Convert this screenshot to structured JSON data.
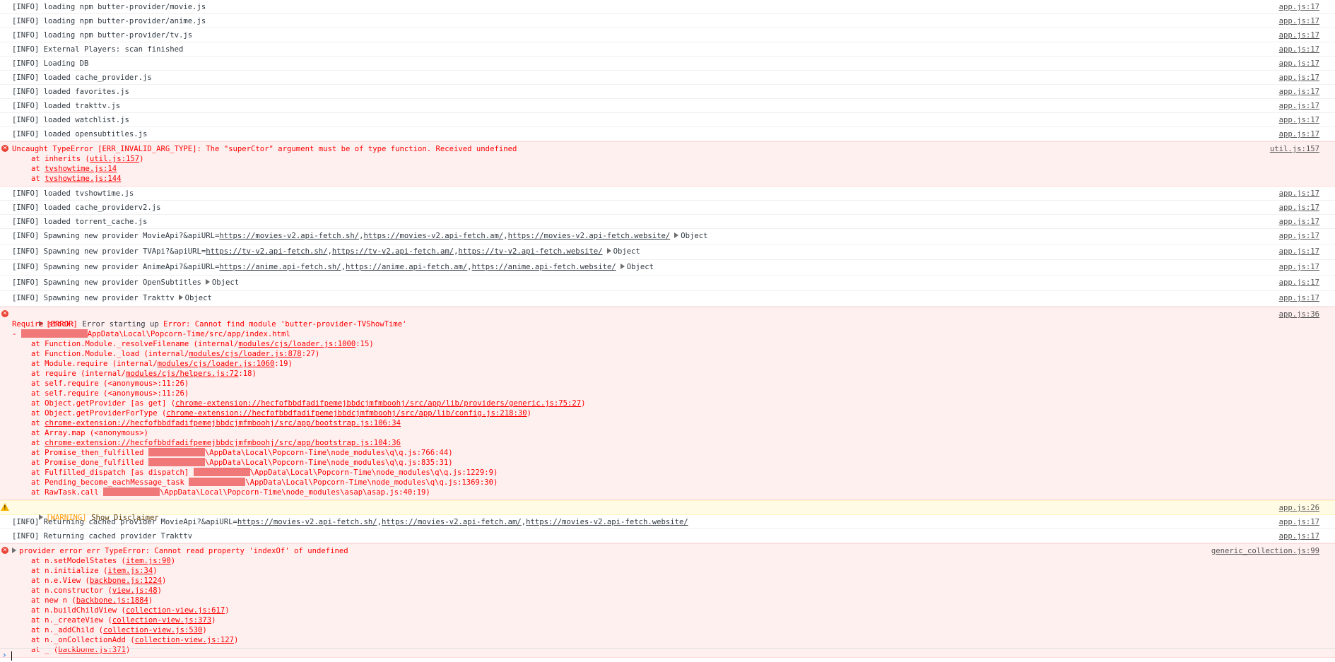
{
  "entries": [
    {
      "kind": "info",
      "text": "[INFO] loading npm butter-provider/movie.js",
      "src": "app.js:17"
    },
    {
      "kind": "info",
      "text": "[INFO] loading npm butter-provider/anime.js",
      "src": "app.js:17"
    },
    {
      "kind": "info",
      "text": "[INFO] loading npm butter-provider/tv.js",
      "src": "app.js:17"
    },
    {
      "kind": "info",
      "text": "[INFO] External Players: scan finished",
      "src": "app.js:17"
    },
    {
      "kind": "info",
      "text": "[INFO] Loading DB",
      "src": "app.js:17"
    },
    {
      "kind": "info",
      "text": "[INFO] loaded cache_provider.js",
      "src": "app.js:17"
    },
    {
      "kind": "info",
      "text": "[INFO] loaded favorites.js",
      "src": "app.js:17"
    },
    {
      "kind": "info",
      "text": "[INFO] loaded trakttv.js",
      "src": "app.js:17"
    },
    {
      "kind": "info",
      "text": "[INFO] loaded watchlist.js",
      "src": "app.js:17"
    },
    {
      "kind": "info",
      "text": "[INFO] loaded opensubtitles.js",
      "src": "app.js:17"
    }
  ],
  "error1": {
    "message": "Uncaught TypeError [ERR_INVALID_ARG_TYPE]: The \"superCtor\" argument must be of type function. Received undefined",
    "src": "util.js:157",
    "stack": [
      {
        "pre": "at inherits (",
        "link": "util.js:157",
        "post": ")"
      },
      {
        "pre": "at ",
        "link": "tvshowtime.js:14",
        "post": ""
      },
      {
        "pre": "at ",
        "link": "tvshowtime.js:144",
        "post": ""
      }
    ]
  },
  "entries2": [
    {
      "text": "[INFO] loaded tvshowtime.js",
      "src": "app.js:17"
    },
    {
      "text": "[INFO] loaded cache_providerv2.js",
      "src": "app.js:17"
    },
    {
      "text": "[INFO] loaded torrent_cache.js",
      "src": "app.js:17"
    }
  ],
  "spawn": [
    {
      "pre": "[INFO] Spawning new provider MovieApi?&apiURL=",
      "links": [
        "https://movies-v2.api-fetch.sh/",
        "https://movies-v2.api-fetch.am/",
        "https://movies-v2.api-fetch.website/"
      ],
      "obj": "Object",
      "src": "app.js:17"
    },
    {
      "pre": "[INFO] Spawning new provider TVApi?&apiURL=",
      "links": [
        "https://tv-v2.api-fetch.sh/",
        "https://tv-v2.api-fetch.am/",
        "https://tv-v2.api-fetch.website/"
      ],
      "obj": "Object",
      "src": "app.js:17"
    },
    {
      "pre": "[INFO] Spawning new provider AnimeApi?&apiURL=",
      "links": [
        "https://anime.api-fetch.sh/",
        "https://anime.api-fetch.am/",
        "https://anime.api-fetch.website/"
      ],
      "obj": "Object",
      "src": "app.js:17"
    },
    {
      "pre": "[INFO] Spawning new provider OpenSubtitles",
      "links": [],
      "obj": "Object",
      "src": "app.js:17"
    },
    {
      "pre": "[INFO] Spawning new provider Trakttv",
      "links": [],
      "obj": "Object",
      "src": "app.js:17"
    }
  ],
  "error2": {
    "tag": "[ERROR]",
    "label": " Error starting up ",
    "message": "Error: Cannot find module 'butter-provider-TVShowTime'",
    "src": "app.js:36",
    "require_stack": "Require stack:",
    "require_dash": "- ",
    "require_path": "AppData\\Local\\Popcorn-Time/src/app/index.html",
    "stack": [
      {
        "pre": "at Function.Module._resolveFilename (internal/",
        "link": "modules/cjs/loader.js:1000",
        "post": ":15)"
      },
      {
        "pre": "at Function.Module._load (internal/",
        "link": "modules/cjs/loader.js:878",
        "post": ":27)"
      },
      {
        "pre": "at Module.require (internal/",
        "link": "modules/cjs/loader.js:1060",
        "post": ":19)"
      },
      {
        "pre": "at require (internal/",
        "link": "modules/cjs/helpers.js:72",
        "post": ":18)"
      },
      {
        "pre": "at self.require (<anonymous>:11:26)",
        "link": "",
        "post": ""
      },
      {
        "pre": "at self.require (<anonymous>:11:26)",
        "link": "",
        "post": ""
      },
      {
        "pre": "at Object.getProvider [as get] (",
        "link": "chrome-extension://hecfofbbdfadifpemejbbdcjmfmboohj/src/app/lib/providers/generic.js:75:27",
        "post": ")"
      },
      {
        "pre": "at Object.getProviderForType (",
        "link": "chrome-extension://hecfofbbdfadifpemejbbdcjmfmboohj/src/app/lib/config.js:218:30",
        "post": ")"
      },
      {
        "pre": "at ",
        "link": "chrome-extension://hecfofbbdfadifpemejbbdcjmfmboohj/src/app/bootstrap.js:106:34",
        "post": ""
      },
      {
        "pre": "at Array.map (<anonymous>)",
        "link": "",
        "post": ""
      },
      {
        "pre": "at ",
        "link": "chrome-extension://hecfofbbdfadifpemejbbdcjmfmboohj/src/app/bootstrap.js:104:36",
        "post": ""
      }
    ],
    "redacted_stack": [
      {
        "pre": "at Promise_then_fulfilled ",
        "post": "\\AppData\\Local\\Popcorn-Time\\node_modules\\q\\q.js:766:44)"
      },
      {
        "pre": "at Promise_done_fulfilled ",
        "post": "\\AppData\\Local\\Popcorn-Time\\node_modules\\q\\q.js:835:31)"
      },
      {
        "pre": "at Fulfilled_dispatch [as dispatch] ",
        "post": "\\AppData\\Local\\Popcorn-Time\\node_modules\\q\\q.js:1229:9)"
      },
      {
        "pre": "at Pending_become_eachMessage_task ",
        "post": "\\AppData\\Local\\Popcorn-Time\\node_modules\\q\\q.js:1369:30)"
      },
      {
        "pre": "at RawTask.call ",
        "post": "\\AppData\\Local\\Popcorn-Time\\node_modules\\asap\\asap.js:40:19)"
      }
    ]
  },
  "warning": {
    "tag": "[WARNING]",
    "text": " Show Disclaimer",
    "src": "app.js:26"
  },
  "returning": [
    {
      "pre": "[INFO] Returning cached provider MovieApi?&apiURL=",
      "links": [
        "https://movies-v2.api-fetch.sh/",
        "https://movies-v2.api-fetch.am/",
        "https://movies-v2.api-fetch.website/"
      ],
      "src": "app.js:17"
    },
    {
      "pre": "[INFO] Returning cached provider Trakttv",
      "links": [],
      "src": "app.js:17"
    }
  ],
  "error3": {
    "message": "provider error err TypeError: Cannot read property 'indexOf' of undefined",
    "src": "generic_collection.js:99",
    "stack": [
      {
        "pre": "at n.setModelStates (",
        "link": "item.js:90",
        "post": ")"
      },
      {
        "pre": "at n.initialize (",
        "link": "item.js:34",
        "post": ")"
      },
      {
        "pre": "at n.e.View (",
        "link": "backbone.js:1224",
        "post": ")"
      },
      {
        "pre": "at n.constructor (",
        "link": "view.js:48",
        "post": ")"
      },
      {
        "pre": "at new n (",
        "link": "backbone.js:1884",
        "post": ")"
      },
      {
        "pre": "at n.buildChildView (",
        "link": "collection-view.js:617",
        "post": ")"
      },
      {
        "pre": "at n._createView (",
        "link": "collection-view.js:373",
        "post": ")"
      },
      {
        "pre": "at n._addChild (",
        "link": "collection-view.js:530",
        "post": ")"
      },
      {
        "pre": "at n._onCollectionAdd (",
        "link": "collection-view.js:127",
        "post": ")"
      },
      {
        "pre": "at _ (",
        "link": "backbone.js:371",
        "post": ")"
      }
    ]
  },
  "prompt": {
    "symbol": "›"
  }
}
